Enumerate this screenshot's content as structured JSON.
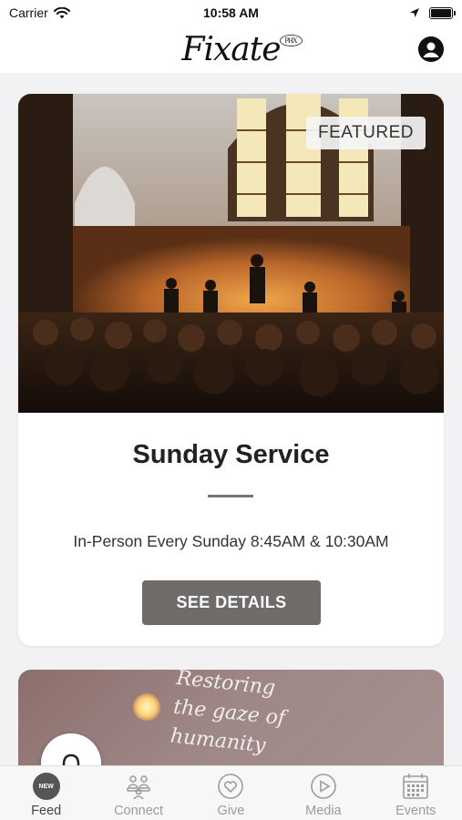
{
  "status_bar": {
    "carrier": "Carrier",
    "time": "10:58 AM"
  },
  "header": {
    "logo_text": "Fixate",
    "logo_badge": "PHX"
  },
  "featured_card": {
    "badge": "FEATURED",
    "title": "Sunday Service",
    "subtitle": "In-Person Every Sunday 8:45AM & 10:30AM",
    "button_label": "SEE DETAILS"
  },
  "second_card": {
    "script_lines": [
      "Restoring",
      "the gaze of",
      "humanity"
    ]
  },
  "tab_bar": {
    "tabs": [
      {
        "label": "Feed",
        "icon": "new-badge-icon",
        "badge": "NEW",
        "active": true
      },
      {
        "label": "Connect",
        "icon": "people-icon",
        "active": false
      },
      {
        "label": "Give",
        "icon": "heart-icon",
        "active": false
      },
      {
        "label": "Media",
        "icon": "play-icon",
        "active": false
      },
      {
        "label": "Events",
        "icon": "calendar-icon",
        "active": false
      }
    ]
  },
  "colors": {
    "button": "#6e6b69",
    "background": "#f2f2f4",
    "tab_inactive": "#9c9c9c",
    "tab_active": "#444444"
  }
}
